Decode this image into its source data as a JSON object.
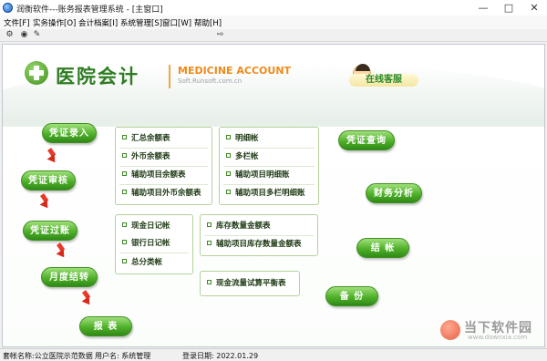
{
  "window": {
    "title": "润衡软件---账务报表管理系统 - [主窗口]"
  },
  "menu": [
    "文件[F]",
    "实务操作[O]",
    "会计档案[I]",
    "系统管理[S]",
    "窗口[W]",
    "帮助[H]"
  ],
  "header": {
    "logo_text": "医院会计",
    "brand_en": "MEDICINE ACCOUNT",
    "brand_url": "Soft.Runsoft.com.cn",
    "service_label": "在线客服"
  },
  "flow": {
    "voucher_entry": "凭证录入",
    "voucher_review": "凭证审核",
    "voucher_posting": "凭证过账",
    "monthly_close": "月度结转",
    "report": "报 表",
    "voucher_query": "凭证查询",
    "financial_analysis": "财务分析",
    "close_account": "结 帐",
    "backup": "备 份"
  },
  "panels": {
    "balance": [
      "汇总余额表",
      "外币余额表",
      "辅助项目余额表",
      "辅助项目外币余额表"
    ],
    "detail": [
      "明细帐",
      "多栏帐",
      "辅助项目明细账",
      "辅助项目多栏明细账"
    ],
    "journal": [
      "现金日记帐",
      "银行日记帐",
      "总分类帐"
    ],
    "inventory": [
      "库存数量金额表",
      "辅助项目库存数量金额表"
    ],
    "cashflow": [
      "现金流量试算平衡表"
    ]
  },
  "status": {
    "account_set": "套帐名称:公立医院示范数据",
    "user": "用户名: 系统管理",
    "login_date": "登录日期: 2022.01.29"
  },
  "watermark": {
    "title": "当下软件园",
    "url": "www.downxia.com"
  },
  "colors": {
    "accent_green": "#4fb02a",
    "arrow_red": "#e83a2a",
    "brand_orange": "#f08a1a"
  }
}
